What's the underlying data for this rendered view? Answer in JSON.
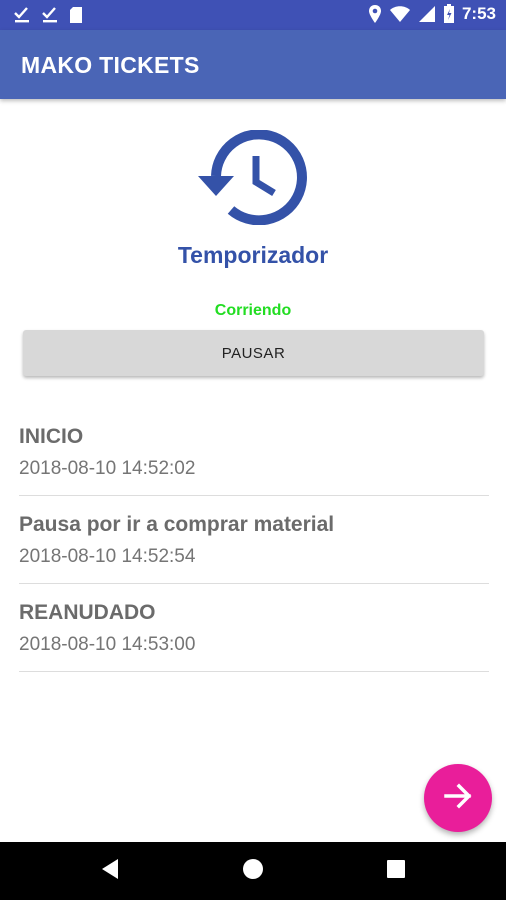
{
  "status_bar": {
    "time": "7:53",
    "left_icons": [
      "check-notification-icon",
      "check-notification-icon",
      "sd-card-icon"
    ],
    "right_icons": [
      "location-icon",
      "wifi-icon",
      "signal-icon",
      "battery-icon"
    ]
  },
  "app_bar": {
    "title": "MAKO TICKETS",
    "color": "#4a65b6"
  },
  "timer": {
    "icon": "history-clock-icon",
    "title": "Temporizador",
    "status": "Corriendo",
    "status_color": "#22dd22"
  },
  "pause_button": {
    "label": "PAUSAR"
  },
  "events": [
    {
      "title": "INICIO",
      "time": "2018-08-10 14:52:02"
    },
    {
      "title": "Pausa por ir a comprar material",
      "time": "2018-08-10 14:52:54"
    },
    {
      "title": "REANUDADO",
      "time": "2018-08-10 14:53:00"
    }
  ],
  "fab": {
    "icon": "arrow-right-icon",
    "color": "#e91e9a"
  },
  "nav_bar": {
    "buttons": [
      "back-icon",
      "home-icon",
      "recents-icon"
    ]
  }
}
